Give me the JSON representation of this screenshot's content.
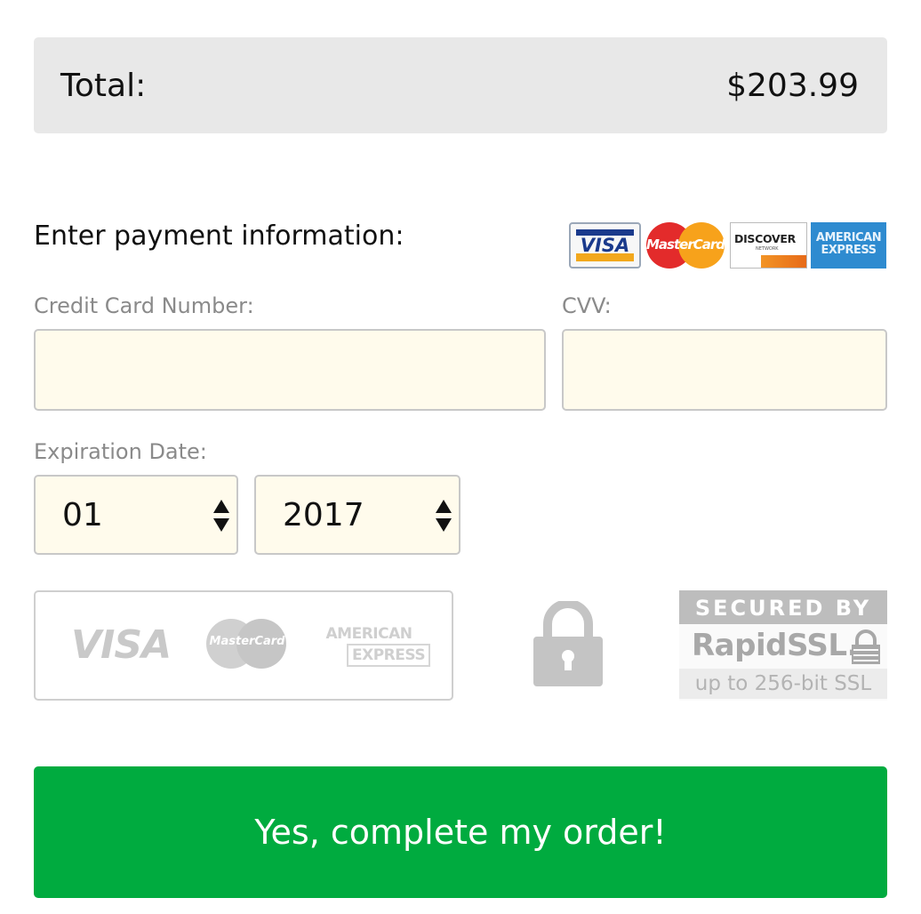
{
  "order": {
    "total_label": "Total:",
    "total_value": "$203.99"
  },
  "payment": {
    "heading": "Enter payment information:",
    "accepted_cards": [
      "VISA",
      "MasterCard",
      "DISCOVER",
      "AMERICAN EXPRESS"
    ],
    "card_logo_text": {
      "visa": "VISA",
      "mastercard": "MasterCard",
      "discover": "DISCOVER",
      "discover_sub": "NETWORK",
      "amex_line1": "AMERICAN",
      "amex_line2": "EXPRESS"
    },
    "card_number": {
      "label": "Credit Card Number:",
      "value": "",
      "placeholder": ""
    },
    "cvv": {
      "label": "CVV:",
      "value": "",
      "placeholder": ""
    },
    "expiration": {
      "label": "Expiration Date:",
      "month": "01",
      "year": "2017"
    }
  },
  "trust": {
    "faded_cards": {
      "visa": "VISA",
      "mastercard": "MasterCard",
      "amex_line1": "AMERICAN",
      "amex_line2": "EXPRESS"
    },
    "ssl": {
      "top": "SECURED BY",
      "brand": "RapidSSL.",
      "bottom": "up to 256-bit SSL"
    }
  },
  "submit": {
    "label": "Yes, complete my order!"
  },
  "colors": {
    "accent_green": "#00ab3f",
    "input_bg": "#fffbec",
    "total_bar_bg": "#e8e8e8"
  }
}
